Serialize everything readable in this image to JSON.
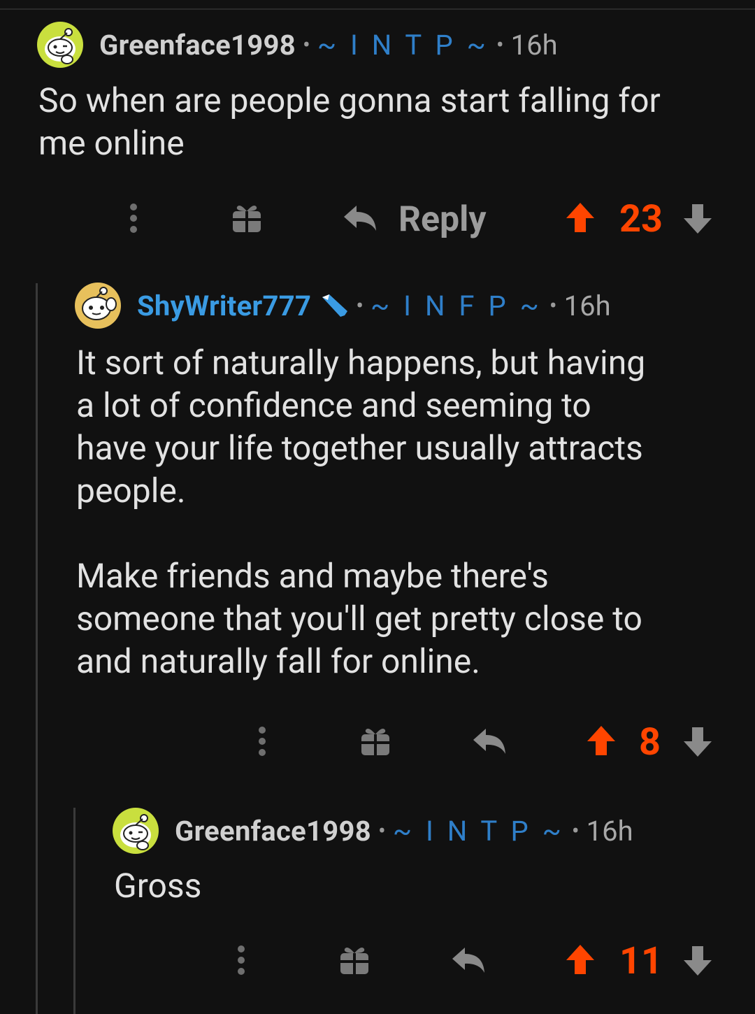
{
  "colors": {
    "background": "#111111",
    "upvote_accent": "#ff4500",
    "flair_blue": "#2f7fc9",
    "username_op": "#3a9be3"
  },
  "separator": "•",
  "comments": [
    {
      "username": "Greenface1998",
      "flair": "~ I N T P ~",
      "time": "16h",
      "body": "So when are people gonna start falling for\nme online",
      "reply_label": "Reply",
      "score": "23",
      "avatar_icon": "snoo-avatar-green-icon"
    },
    {
      "username": "ShyWriter777",
      "flair": "~ I N F P ~",
      "time": "16h",
      "body": "It sort of naturally happens, but having\na lot of confidence and seeming to\nhave your life together usually attracts\npeople.\n\nMake friends and maybe there's\nsomeone that you'll get pretty close to\nand naturally fall for online.",
      "score": "8",
      "avatar_icon": "snoo-avatar-yellow-icon",
      "badge_icon": "pencil-icon"
    },
    {
      "username": "Greenface1998",
      "flair": "~ I N T P ~",
      "time": "16h",
      "body": "Gross",
      "score": "11",
      "avatar_icon": "snoo-avatar-green-icon"
    }
  ]
}
